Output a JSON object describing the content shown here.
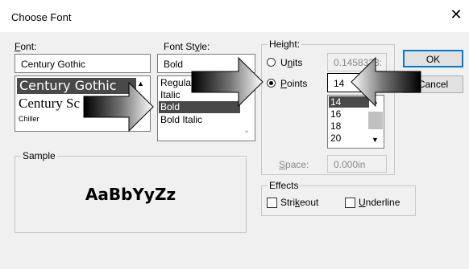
{
  "window": {
    "title": "Choose Font",
    "close_glyph": "✕"
  },
  "font": {
    "label_prefix": "",
    "label_key": "F",
    "label_rest": "ont:",
    "value": "Century Gothic",
    "items": [
      "Century Gothic",
      "Century Sc",
      "Chiller"
    ]
  },
  "style": {
    "label_prefix": "Font St",
    "label_key": "y",
    "label_rest": "le:",
    "value": "Bold",
    "items": [
      "Regula",
      "Italic",
      "Bold",
      "Bold Italic"
    ]
  },
  "height": {
    "label": "Height:",
    "units_prefix": "U",
    "units_key": "n",
    "units_rest": "its",
    "units_value": "0.1458333:",
    "points_prefix": "",
    "points_key": "P",
    "points_rest": "oints",
    "points_value": "14",
    "point_items": [
      "14",
      "16",
      "18",
      "20"
    ],
    "space_prefix": "",
    "space_key": "S",
    "space_rest": "pace:",
    "space_value": "0.000in"
  },
  "buttons": {
    "ok": "OK",
    "cancel": "Cancel"
  },
  "sample": {
    "label": "Sample",
    "text": "AaBbYyZz"
  },
  "effects": {
    "label": "Effects",
    "strikeout_prefix": "Stri",
    "strikeout_key": "k",
    "strikeout_rest": "eout",
    "underline_prefix": "",
    "underline_key": "U",
    "underline_rest": "nderline"
  },
  "colors": {
    "selection": "#494949",
    "background": "#f0f0f0",
    "field": "#ffffff"
  }
}
